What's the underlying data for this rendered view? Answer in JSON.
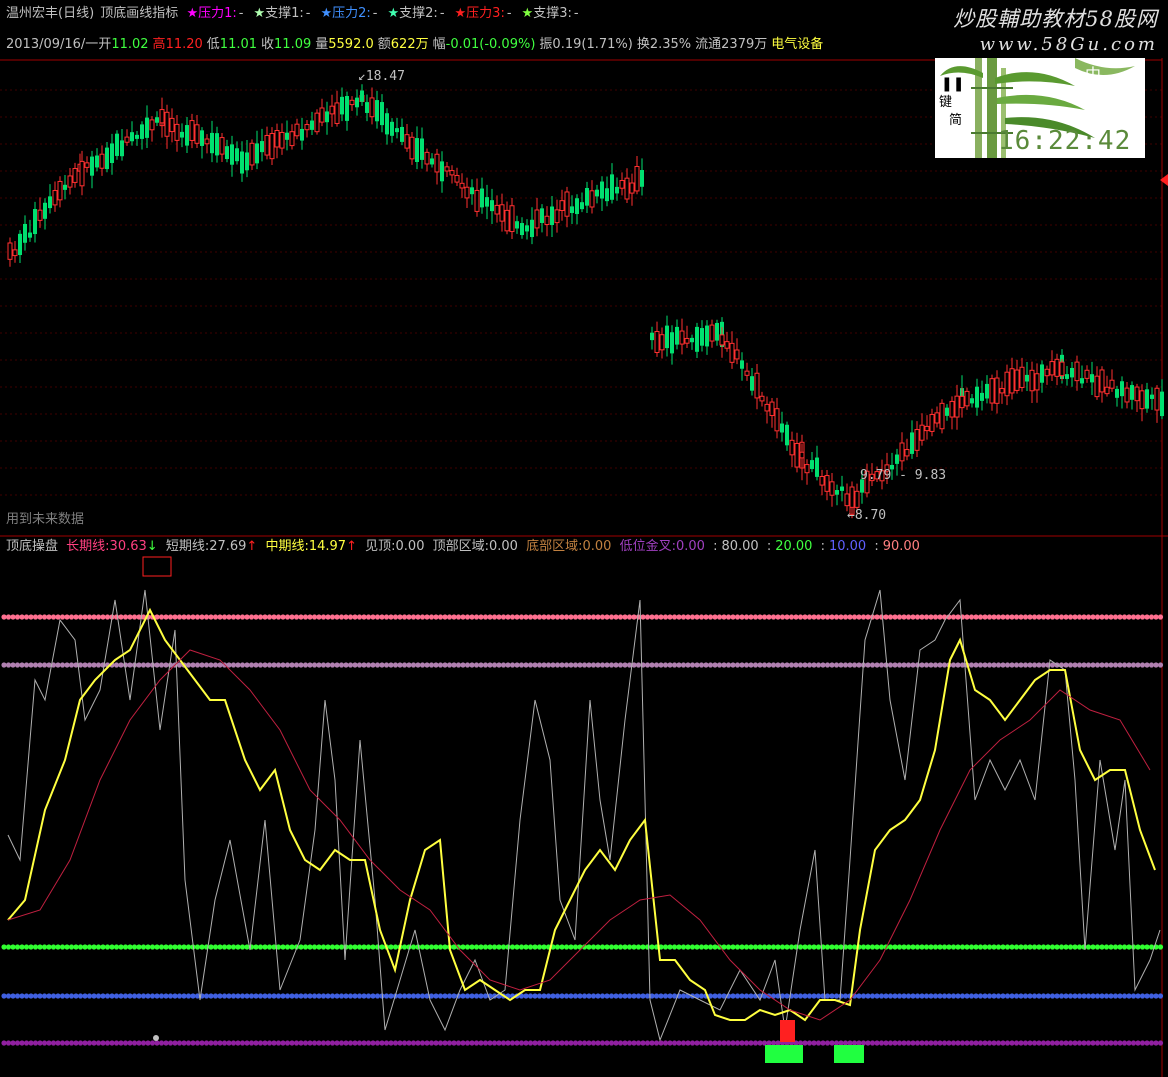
{
  "title_row": {
    "stock": "温州宏丰(日线)",
    "indicator": "顶底画线指标",
    "items": [
      {
        "star": "★",
        "label": "压力1:",
        "value": "-",
        "star_color": "#ff00ff",
        "label_color": "#ff00ff"
      },
      {
        "star": "★",
        "label": "支撑1:",
        "value": "-",
        "star_color": "#b0ffb0",
        "label_color": "#c0c0c0"
      },
      {
        "star": "★",
        "label": "压力2:",
        "value": "-",
        "star_color": "#4090ff",
        "label_color": "#4090ff"
      },
      {
        "star": "★",
        "label": "支撑2:",
        "value": "-",
        "star_color": "#40ffb0",
        "label_color": "#c0c0c0"
      },
      {
        "star": "★",
        "label": "压力3:",
        "value": "-",
        "star_color": "#ff2020",
        "label_color": "#ff2020"
      },
      {
        "star": "★",
        "label": "支撑3:",
        "value": "-",
        "star_color": "#80ff40",
        "label_color": "#c0c0c0"
      }
    ]
  },
  "quote_row": {
    "date": "2013/09/16/一",
    "open_label": "开",
    "open": "11.02",
    "high_label": "高",
    "high": "11.20",
    "low_label": "低",
    "low": "11.01",
    "close_label": "收",
    "close": "11.09",
    "volume_label": "量",
    "volume": "5592.0",
    "amount_label": "额",
    "amount": "622万",
    "change_label": "幅",
    "change": "-0.01(-0.09%)",
    "amplitude_label": "振",
    "amplitude": "0.19(1.71%)",
    "turnover_label": "换",
    "turnover": "2.35%",
    "float_label": "流通",
    "float": "2379万",
    "sector": "电气设备"
  },
  "watermark": {
    "line1": "炒股輔助教材58股网",
    "line2": "www.58Gu.com"
  },
  "clock": "16:22:42",
  "future_data": "用到未来数据",
  "price_labels": {
    "high": "18.47",
    "low": "8.70",
    "range": "9.79 - 9.83"
  },
  "indicator_row": {
    "name": "顶底操盘",
    "long_label": "长期线:",
    "long_value": "30.63",
    "long_arrow": "↓",
    "short_label": "短期线:",
    "short_value": "27.69",
    "short_arrow": "↑",
    "mid_label": "中期线:",
    "mid_value": "14.97",
    "mid_arrow": "↑",
    "top_label": "见顶:",
    "top_value": "0.00",
    "top_zone_label": "顶部区域:",
    "top_zone_value": "0.00",
    "bottom_zone_label": "底部区域:",
    "bottom_zone_value": "0.00",
    "low_cross_label": "低位金叉:",
    "low_cross_value": "0.00",
    "lv1": "80.00",
    "lv2": "20.00",
    "lv3": "10.00",
    "lv4": "90.00",
    "colors": {
      "long": "#ff4080",
      "short": "#c0c0c0",
      "mid": "#ffff40",
      "top": "#c0c0c0",
      "bottom": "#c08040",
      "cross": "#a040c0",
      "lv1": "#c0c0c0",
      "lv2": "#40ff40",
      "lv3": "#6060ff",
      "lv4": "#ff8080"
    }
  }
}
